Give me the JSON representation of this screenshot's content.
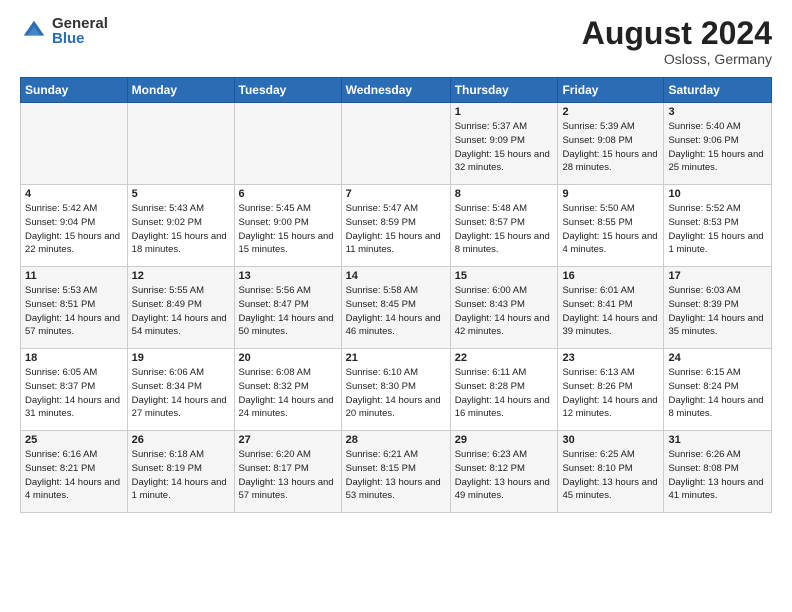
{
  "header": {
    "logo": {
      "general": "General",
      "blue": "Blue"
    },
    "month_year": "August 2024",
    "location": "Osloss, Germany"
  },
  "weekdays": [
    "Sunday",
    "Monday",
    "Tuesday",
    "Wednesday",
    "Thursday",
    "Friday",
    "Saturday"
  ],
  "weeks": [
    [
      {
        "day": "",
        "sunrise": "",
        "sunset": "",
        "daylight": ""
      },
      {
        "day": "",
        "sunrise": "",
        "sunset": "",
        "daylight": ""
      },
      {
        "day": "",
        "sunrise": "",
        "sunset": "",
        "daylight": ""
      },
      {
        "day": "",
        "sunrise": "",
        "sunset": "",
        "daylight": ""
      },
      {
        "day": "1",
        "sunrise": "Sunrise: 5:37 AM",
        "sunset": "Sunset: 9:09 PM",
        "daylight": "Daylight: 15 hours and 32 minutes."
      },
      {
        "day": "2",
        "sunrise": "Sunrise: 5:39 AM",
        "sunset": "Sunset: 9:08 PM",
        "daylight": "Daylight: 15 hours and 28 minutes."
      },
      {
        "day": "3",
        "sunrise": "Sunrise: 5:40 AM",
        "sunset": "Sunset: 9:06 PM",
        "daylight": "Daylight: 15 hours and 25 minutes."
      }
    ],
    [
      {
        "day": "4",
        "sunrise": "Sunrise: 5:42 AM",
        "sunset": "Sunset: 9:04 PM",
        "daylight": "Daylight: 15 hours and 22 minutes."
      },
      {
        "day": "5",
        "sunrise": "Sunrise: 5:43 AM",
        "sunset": "Sunset: 9:02 PM",
        "daylight": "Daylight: 15 hours and 18 minutes."
      },
      {
        "day": "6",
        "sunrise": "Sunrise: 5:45 AM",
        "sunset": "Sunset: 9:00 PM",
        "daylight": "Daylight: 15 hours and 15 minutes."
      },
      {
        "day": "7",
        "sunrise": "Sunrise: 5:47 AM",
        "sunset": "Sunset: 8:59 PM",
        "daylight": "Daylight: 15 hours and 11 minutes."
      },
      {
        "day": "8",
        "sunrise": "Sunrise: 5:48 AM",
        "sunset": "Sunset: 8:57 PM",
        "daylight": "Daylight: 15 hours and 8 minutes."
      },
      {
        "day": "9",
        "sunrise": "Sunrise: 5:50 AM",
        "sunset": "Sunset: 8:55 PM",
        "daylight": "Daylight: 15 hours and 4 minutes."
      },
      {
        "day": "10",
        "sunrise": "Sunrise: 5:52 AM",
        "sunset": "Sunset: 8:53 PM",
        "daylight": "Daylight: 15 hours and 1 minute."
      }
    ],
    [
      {
        "day": "11",
        "sunrise": "Sunrise: 5:53 AM",
        "sunset": "Sunset: 8:51 PM",
        "daylight": "Daylight: 14 hours and 57 minutes."
      },
      {
        "day": "12",
        "sunrise": "Sunrise: 5:55 AM",
        "sunset": "Sunset: 8:49 PM",
        "daylight": "Daylight: 14 hours and 54 minutes."
      },
      {
        "day": "13",
        "sunrise": "Sunrise: 5:56 AM",
        "sunset": "Sunset: 8:47 PM",
        "daylight": "Daylight: 14 hours and 50 minutes."
      },
      {
        "day": "14",
        "sunrise": "Sunrise: 5:58 AM",
        "sunset": "Sunset: 8:45 PM",
        "daylight": "Daylight: 14 hours and 46 minutes."
      },
      {
        "day": "15",
        "sunrise": "Sunrise: 6:00 AM",
        "sunset": "Sunset: 8:43 PM",
        "daylight": "Daylight: 14 hours and 42 minutes."
      },
      {
        "day": "16",
        "sunrise": "Sunrise: 6:01 AM",
        "sunset": "Sunset: 8:41 PM",
        "daylight": "Daylight: 14 hours and 39 minutes."
      },
      {
        "day": "17",
        "sunrise": "Sunrise: 6:03 AM",
        "sunset": "Sunset: 8:39 PM",
        "daylight": "Daylight: 14 hours and 35 minutes."
      }
    ],
    [
      {
        "day": "18",
        "sunrise": "Sunrise: 6:05 AM",
        "sunset": "Sunset: 8:37 PM",
        "daylight": "Daylight: 14 hours and 31 minutes."
      },
      {
        "day": "19",
        "sunrise": "Sunrise: 6:06 AM",
        "sunset": "Sunset: 8:34 PM",
        "daylight": "Daylight: 14 hours and 27 minutes."
      },
      {
        "day": "20",
        "sunrise": "Sunrise: 6:08 AM",
        "sunset": "Sunset: 8:32 PM",
        "daylight": "Daylight: 14 hours and 24 minutes."
      },
      {
        "day": "21",
        "sunrise": "Sunrise: 6:10 AM",
        "sunset": "Sunset: 8:30 PM",
        "daylight": "Daylight: 14 hours and 20 minutes."
      },
      {
        "day": "22",
        "sunrise": "Sunrise: 6:11 AM",
        "sunset": "Sunset: 8:28 PM",
        "daylight": "Daylight: 14 hours and 16 minutes."
      },
      {
        "day": "23",
        "sunrise": "Sunrise: 6:13 AM",
        "sunset": "Sunset: 8:26 PM",
        "daylight": "Daylight: 14 hours and 12 minutes."
      },
      {
        "day": "24",
        "sunrise": "Sunrise: 6:15 AM",
        "sunset": "Sunset: 8:24 PM",
        "daylight": "Daylight: 14 hours and 8 minutes."
      }
    ],
    [
      {
        "day": "25",
        "sunrise": "Sunrise: 6:16 AM",
        "sunset": "Sunset: 8:21 PM",
        "daylight": "Daylight: 14 hours and 4 minutes."
      },
      {
        "day": "26",
        "sunrise": "Sunrise: 6:18 AM",
        "sunset": "Sunset: 8:19 PM",
        "daylight": "Daylight: 14 hours and 1 minute."
      },
      {
        "day": "27",
        "sunrise": "Sunrise: 6:20 AM",
        "sunset": "Sunset: 8:17 PM",
        "daylight": "Daylight: 13 hours and 57 minutes."
      },
      {
        "day": "28",
        "sunrise": "Sunrise: 6:21 AM",
        "sunset": "Sunset: 8:15 PM",
        "daylight": "Daylight: 13 hours and 53 minutes."
      },
      {
        "day": "29",
        "sunrise": "Sunrise: 6:23 AM",
        "sunset": "Sunset: 8:12 PM",
        "daylight": "Daylight: 13 hours and 49 minutes."
      },
      {
        "day": "30",
        "sunrise": "Sunrise: 6:25 AM",
        "sunset": "Sunset: 8:10 PM",
        "daylight": "Daylight: 13 hours and 45 minutes."
      },
      {
        "day": "31",
        "sunrise": "Sunrise: 6:26 AM",
        "sunset": "Sunset: 8:08 PM",
        "daylight": "Daylight: 13 hours and 41 minutes."
      }
    ]
  ]
}
